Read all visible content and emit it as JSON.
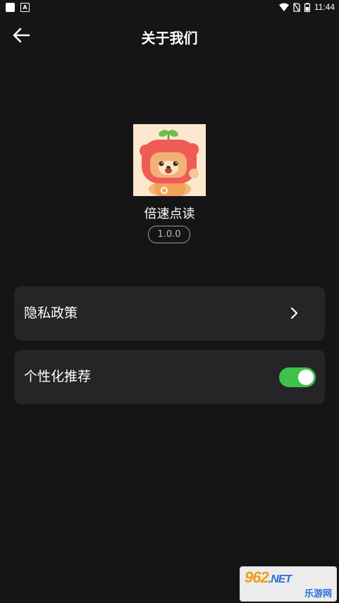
{
  "status_bar": {
    "time": "11:44"
  },
  "header": {
    "title": "关于我们"
  },
  "app": {
    "name": "倍速点读",
    "version": "1.0.0"
  },
  "settings": [
    {
      "label": "隐私政策",
      "control": "chevron"
    },
    {
      "label": "个性化推荐",
      "control": "toggle",
      "enabled": true
    }
  ],
  "watermark": {
    "main": "962",
    "suffix": ".NET",
    "sub": "乐游网"
  },
  "colors": {
    "background": "#151515",
    "card": "#252528",
    "toggle_on": "#3ec24b"
  }
}
